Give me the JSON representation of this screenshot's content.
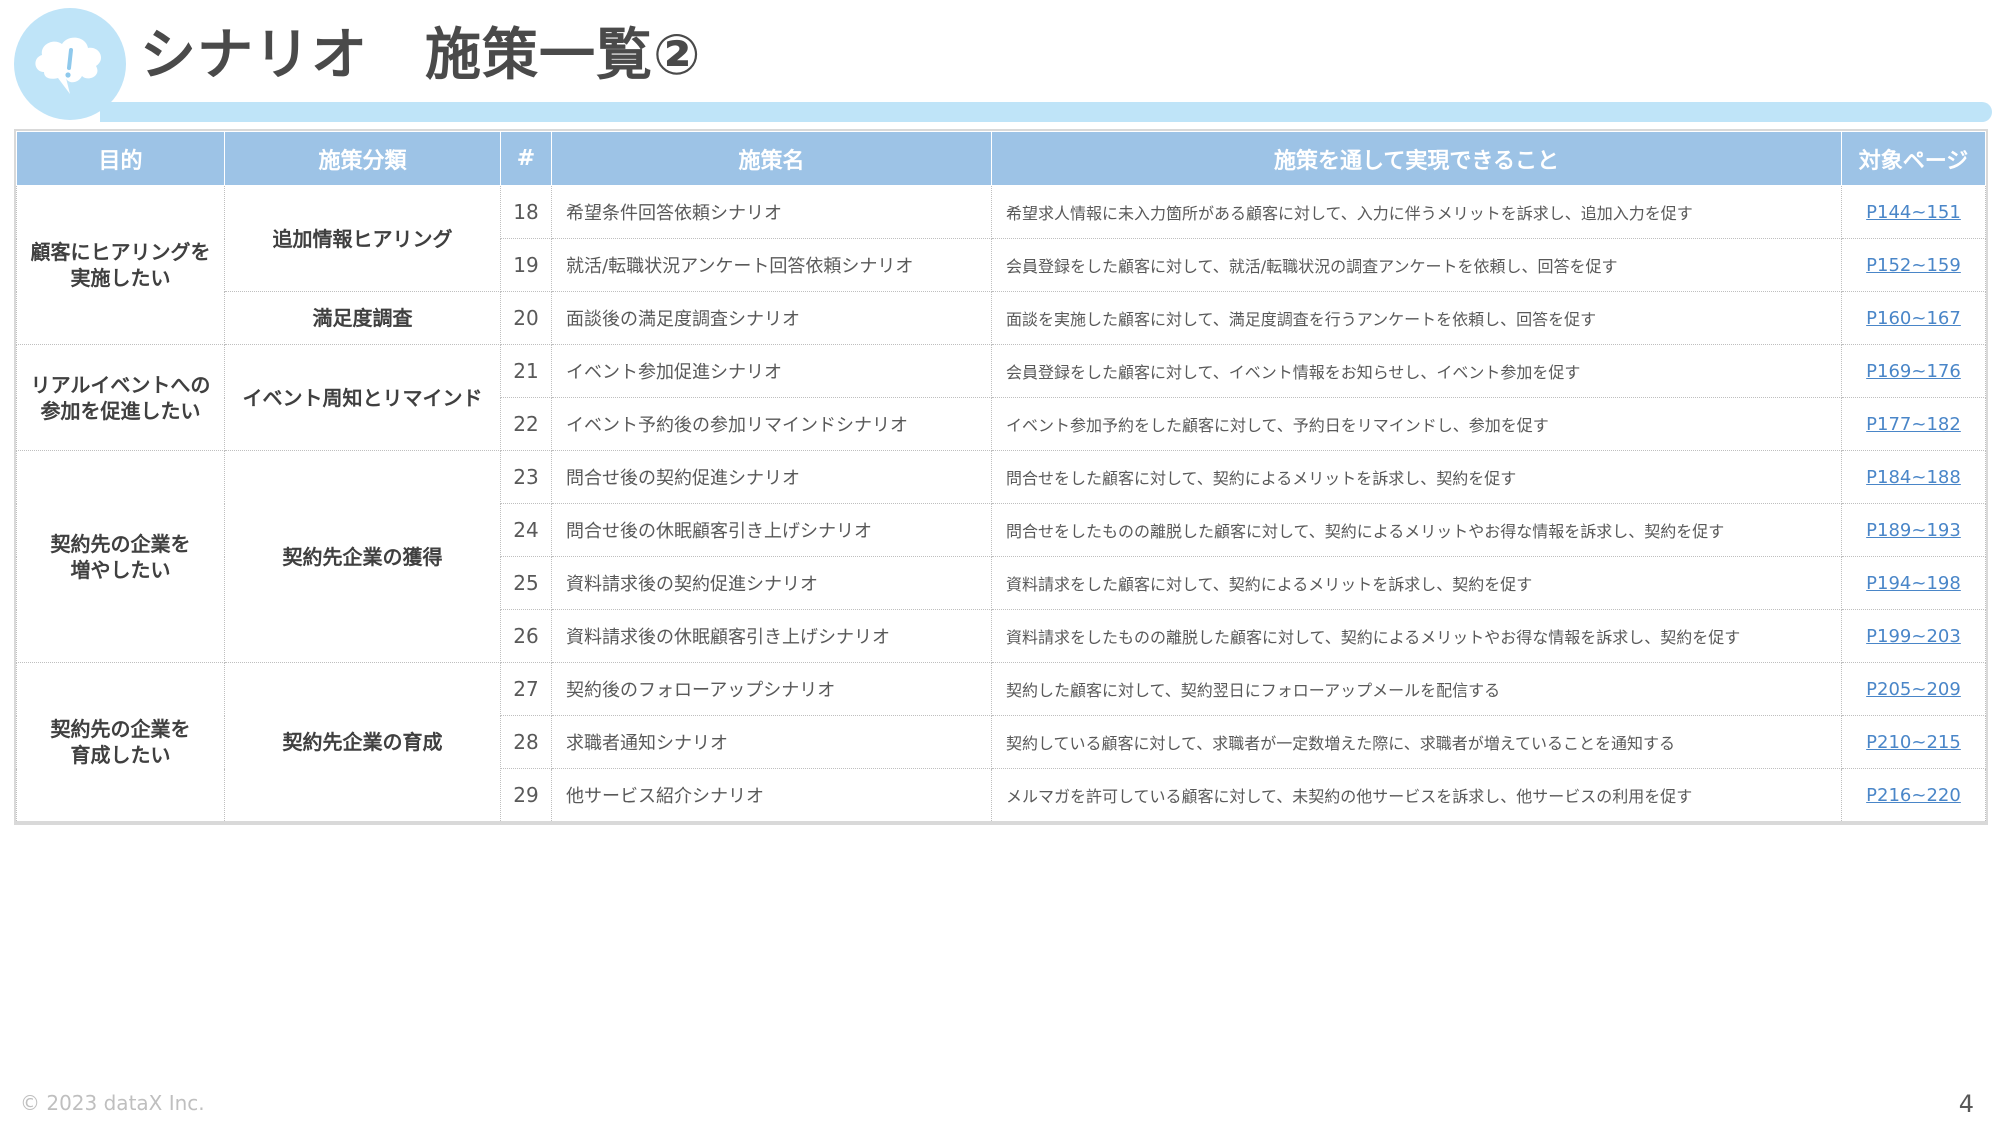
{
  "header": {
    "icon": "thought-bubble-exclamation-icon",
    "title": "シナリオ　施策一覧②"
  },
  "table": {
    "columns": [
      "目的",
      "施策分類",
      "#",
      "施策名",
      "施策を通して実現できること",
      "対象ページ"
    ],
    "groups": [
      {
        "purpose": "顧客にヒアリングを\n実施したい",
        "categories": [
          {
            "name": "追加情報ヒアリング",
            "rows": [
              {
                "num": "18",
                "name": "希望条件回答依頼シナリオ",
                "desc": "希望求人情報に未入力箇所がある顧客に対して、入力に伴うメリットを訴求し、追加入力を促す",
                "page": "P144~151"
              },
              {
                "num": "19",
                "name": "就活/転職状況アンケート回答依頼シナリオ",
                "desc": "会員登録をした顧客に対して、就活/転職状況の調査アンケートを依頼し、回答を促す",
                "page": "P152~159"
              }
            ]
          },
          {
            "name": "満足度調査",
            "rows": [
              {
                "num": "20",
                "name": "面談後の満足度調査シナリオ",
                "desc": "面談を実施した顧客に対して、満足度調査を行うアンケートを依頼し、回答を促す",
                "page": "P160~167"
              }
            ]
          }
        ]
      },
      {
        "purpose": "リアルイベントへの\n参加を促進したい",
        "categories": [
          {
            "name": "イベント周知とリマインド",
            "rows": [
              {
                "num": "21",
                "name": "イベント参加促進シナリオ",
                "desc": "会員登録をした顧客に対して、イベント情報をお知らせし、イベント参加を促す",
                "page": "P169~176"
              },
              {
                "num": "22",
                "name": "イベント予約後の参加リマインドシナリオ",
                "desc": "イベント参加予約をした顧客に対して、予約日をリマインドし、参加を促す",
                "page": "P177~182"
              }
            ]
          }
        ]
      },
      {
        "purpose": "契約先の企業を\n増やしたい",
        "categories": [
          {
            "name": "契約先企業の獲得",
            "rows": [
              {
                "num": "23",
                "name": "問合せ後の契約促進シナリオ",
                "desc": "問合せをした顧客に対して、契約によるメリットを訴求し、契約を促す",
                "page": "P184~188"
              },
              {
                "num": "24",
                "name": "問合せ後の休眠顧客引き上げシナリオ",
                "desc": "問合せをしたものの離脱した顧客に対して、契約によるメリットやお得な情報を訴求し、契約を促す",
                "page": "P189~193"
              },
              {
                "num": "25",
                "name": "資料請求後の契約促進シナリオ",
                "desc": "資料請求をした顧客に対して、契約によるメリットを訴求し、契約を促す",
                "page": "P194~198"
              },
              {
                "num": "26",
                "name": "資料請求後の休眠顧客引き上げシナリオ",
                "desc": "資料請求をしたものの離脱した顧客に対して、契約によるメリットやお得な情報を訴求し、契約を促す",
                "page": "P199~203"
              }
            ]
          }
        ]
      },
      {
        "purpose": "契約先の企業を\n育成したい",
        "categories": [
          {
            "name": "契約先企業の育成",
            "rows": [
              {
                "num": "27",
                "name": "契約後のフォローアップシナリオ",
                "desc": "契約した顧客に対して、契約翌日にフォローアップメールを配信する",
                "page": "P205~209"
              },
              {
                "num": "28",
                "name": "求職者通知シナリオ",
                "desc": "契約している顧客に対して、求職者が一定数増えた際に、求職者が増えていることを通知する",
                "page": "P210~215"
              },
              {
                "num": "29",
                "name": "他サービス紹介シナリオ",
                "desc": "メルマガを許可している顧客に対して、未契約の他サービスを訴求し、他サービスの利用を促す",
                "page": "P216~220"
              }
            ]
          }
        ]
      }
    ]
  },
  "footer": {
    "copyright": "© 2023 dataX Inc.",
    "page_number": "4"
  }
}
